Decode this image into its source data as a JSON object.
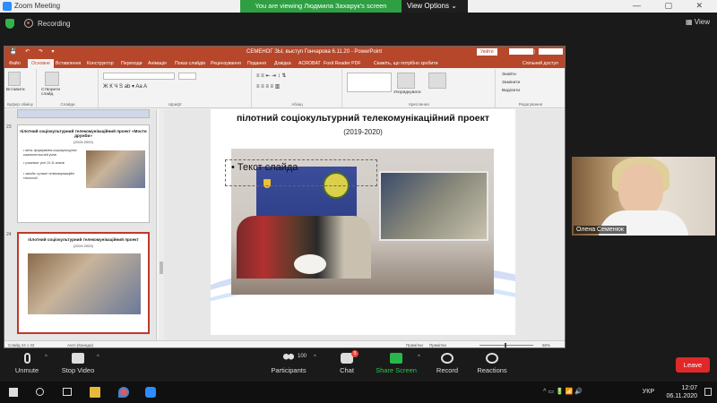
{
  "window": {
    "title": "Zoom Meeting",
    "controls": "— ▢ ✕"
  },
  "banner": {
    "viewing": "You are viewing Людмила Захарук's screen",
    "view_options": "View Options ⌄"
  },
  "status_row": {
    "recording": "Recording",
    "view": "View"
  },
  "ppt": {
    "doc_title": "СЕМЕНОГ ЗЫ, выступ Гончарова 6.11.20 - PowerPoint",
    "sign_in": "Увійти",
    "qa": "💾 ↶ ↷ ▾",
    "win_ctrls": "— ▢ ✕",
    "tabs": [
      "Файл",
      "Основне",
      "Вставлення",
      "Конструктор",
      "Переходи",
      "Анімація",
      "Показ слайдів",
      "Рецензування",
      "Подання",
      "Довідка",
      "ACROBAT",
      "Foxit Reader PDF",
      "Скажіть, що потрібно зробити",
      "Спільний доступ"
    ],
    "ribbon_groups": [
      "Буфер обміну",
      "Слайди",
      "Шрифт",
      "Абзац",
      "Креслення",
      "Редагування"
    ],
    "ribbon_labels": {
      "paste": "Вставити",
      "new_slide": "Створити слайд",
      "arrange": "Упорядкувати",
      "find": "Знайти",
      "replace": "Замінити",
      "select": "Виділити"
    },
    "thumbs": [
      {
        "num": "23",
        "title": "пілотний соціокультурний телекомунікаційний проект «Мости дружби»",
        "years": "(2019-2020)",
        "bullets": [
          "• мета: формування соціокультурних компетентностей учнів",
          "• учасники: учні 10-11 класів",
          "• засоби: сучасні телекомунікаційні технології"
        ]
      },
      {
        "num": "24",
        "title": "пілотний соціокультурний телекомунікаційний проект",
        "years": "(2019-2020)"
      }
    ],
    "slide": {
      "title": "пілотний соціокультурний телекомунікаційний проект",
      "years": "(2019-2020)",
      "placeholder": "• Текст слайда"
    },
    "status": {
      "slide_no": "Слайд 24 з 32",
      "lang": "Англ (Канада)",
      "notes": "Примітки",
      "comments": "Примітки",
      "zoom": "66%"
    }
  },
  "participant": {
    "name": "Олена Семенюк"
  },
  "toolbar": {
    "unmute": "Unmute",
    "stop_video": "Stop Video",
    "participants": "Participants",
    "participants_count": "100",
    "chat": "Chat",
    "chat_badge": "5",
    "share": "Share Screen",
    "record": "Record",
    "reactions": "Reactions",
    "leave": "Leave"
  },
  "taskbar": {
    "lang": "УКР",
    "time": "12:07",
    "date": "06.11.2020"
  }
}
